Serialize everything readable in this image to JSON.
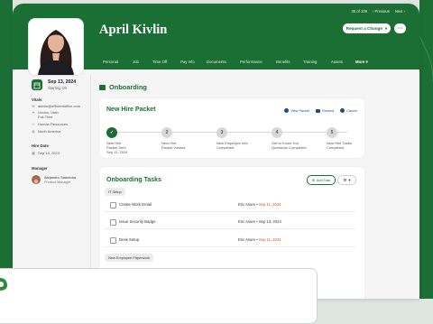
{
  "header": {
    "pager": {
      "position": "45 of 109",
      "previous": "Previous",
      "next": "Next"
    },
    "employee_name": "April Kivlin",
    "request_change": "Request a Change",
    "more_icon": "more-horizontal-icon",
    "brand_color": "#1b6f34"
  },
  "tabs": [
    "Personal",
    "Job",
    "Time Off",
    "Pay Info",
    "Documents",
    "Performance",
    "Benefits",
    "Training",
    "Assets",
    "More"
  ],
  "sidebar": {
    "date": "Sep 13, 2024",
    "date_sub": "Starting On",
    "vitals_heading": "Vitals",
    "vitals": [
      {
        "icon": "mail-icon",
        "text": "akivlin@efficientoffice.com"
      },
      {
        "icon": "location-icon",
        "text": "Lindon, Utah"
      },
      {
        "icon": "",
        "text": "Full-Time"
      },
      {
        "icon": "people-icon",
        "text": "Human Resources"
      },
      {
        "icon": "globe-icon",
        "text": "North America"
      }
    ],
    "hire_heading": "Hire Date",
    "hire_date": "Sep 13, 2024",
    "manager_heading": "Manager",
    "manager_name": "Alejandro Saavedra",
    "manager_title": "Product Manager"
  },
  "onboarding": {
    "title": "Onboarding",
    "packet": {
      "title": "New Hire Packet",
      "actions": {
        "view": "View Packet",
        "resend": "Resend",
        "cancel": "Cancel"
      },
      "steps": [
        {
          "marker": "✓",
          "done": true,
          "label1": "New Hire",
          "label2": "Packet Sent",
          "label3": "Sep 11, 2024"
        },
        {
          "marker": "2",
          "done": false,
          "label1": "New Hire",
          "label2": "Packet Viewed",
          "label3": ""
        },
        {
          "marker": "3",
          "done": false,
          "label1": "New Employee Info",
          "label2": "Completed",
          "label3": ""
        },
        {
          "marker": "4",
          "done": false,
          "label1": "Get to Know You",
          "label2": "Questions Completed",
          "label3": ""
        },
        {
          "marker": "5",
          "done": false,
          "label1": "New Hire Tasks",
          "label2": "Completed",
          "label3": ""
        }
      ]
    },
    "tasks": {
      "title": "Onboarding Tasks",
      "add_task": "Add Task",
      "categories": [
        "IT Setup",
        "New Employee Paperwork"
      ],
      "rows": [
        {
          "name": "Create Work Email",
          "assignee": "Eric Asure",
          "date": "Sep 11, 2024",
          "overdue": true
        },
        {
          "name": "Issue Security Badge",
          "assignee": "Eric Asure",
          "date": "Sep 13, 2024",
          "overdue": false
        },
        {
          "name": "Desk Setup",
          "assignee": "Eric Asure",
          "date": "Sep 11, 2024",
          "overdue": true
        }
      ],
      "overdue_color": "#d2552a"
    }
  }
}
